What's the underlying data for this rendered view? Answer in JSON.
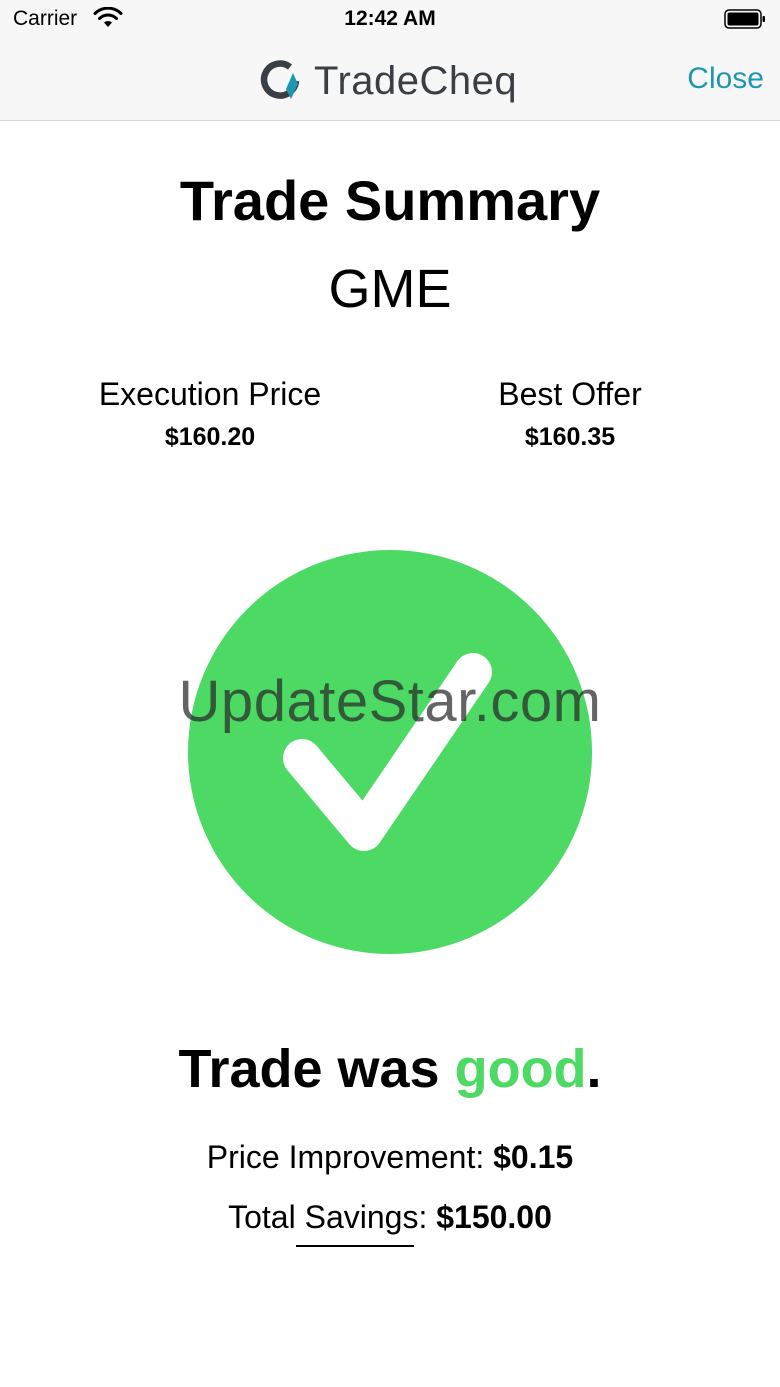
{
  "status_bar": {
    "carrier": "Carrier",
    "time": "12:42 AM",
    "icons": [
      "wifi-icon",
      "battery-icon"
    ]
  },
  "nav": {
    "logo_text": "TradeCheq",
    "close_label": "Close"
  },
  "summary": {
    "title": "Trade Summary",
    "symbol": "GME",
    "execution_price_label": "Execution Price",
    "execution_price_value": "$160.20",
    "best_offer_label": "Best Offer",
    "best_offer_value": "$160.35"
  },
  "result": {
    "icon": "checkmark-circle-icon",
    "verdict_prefix": "Trade was ",
    "verdict_word": "good",
    "verdict_suffix": ".",
    "price_improvement_label": "Price Improvement:",
    "price_improvement_value": "$0.15",
    "total_savings_label": "Total Savings:",
    "total_savings_value": "$150.00"
  },
  "watermark": "UpdateStar.com",
  "colors": {
    "accent": "#1e97b2",
    "success": "#4cd964",
    "nav_background": "#f7f7f7"
  }
}
